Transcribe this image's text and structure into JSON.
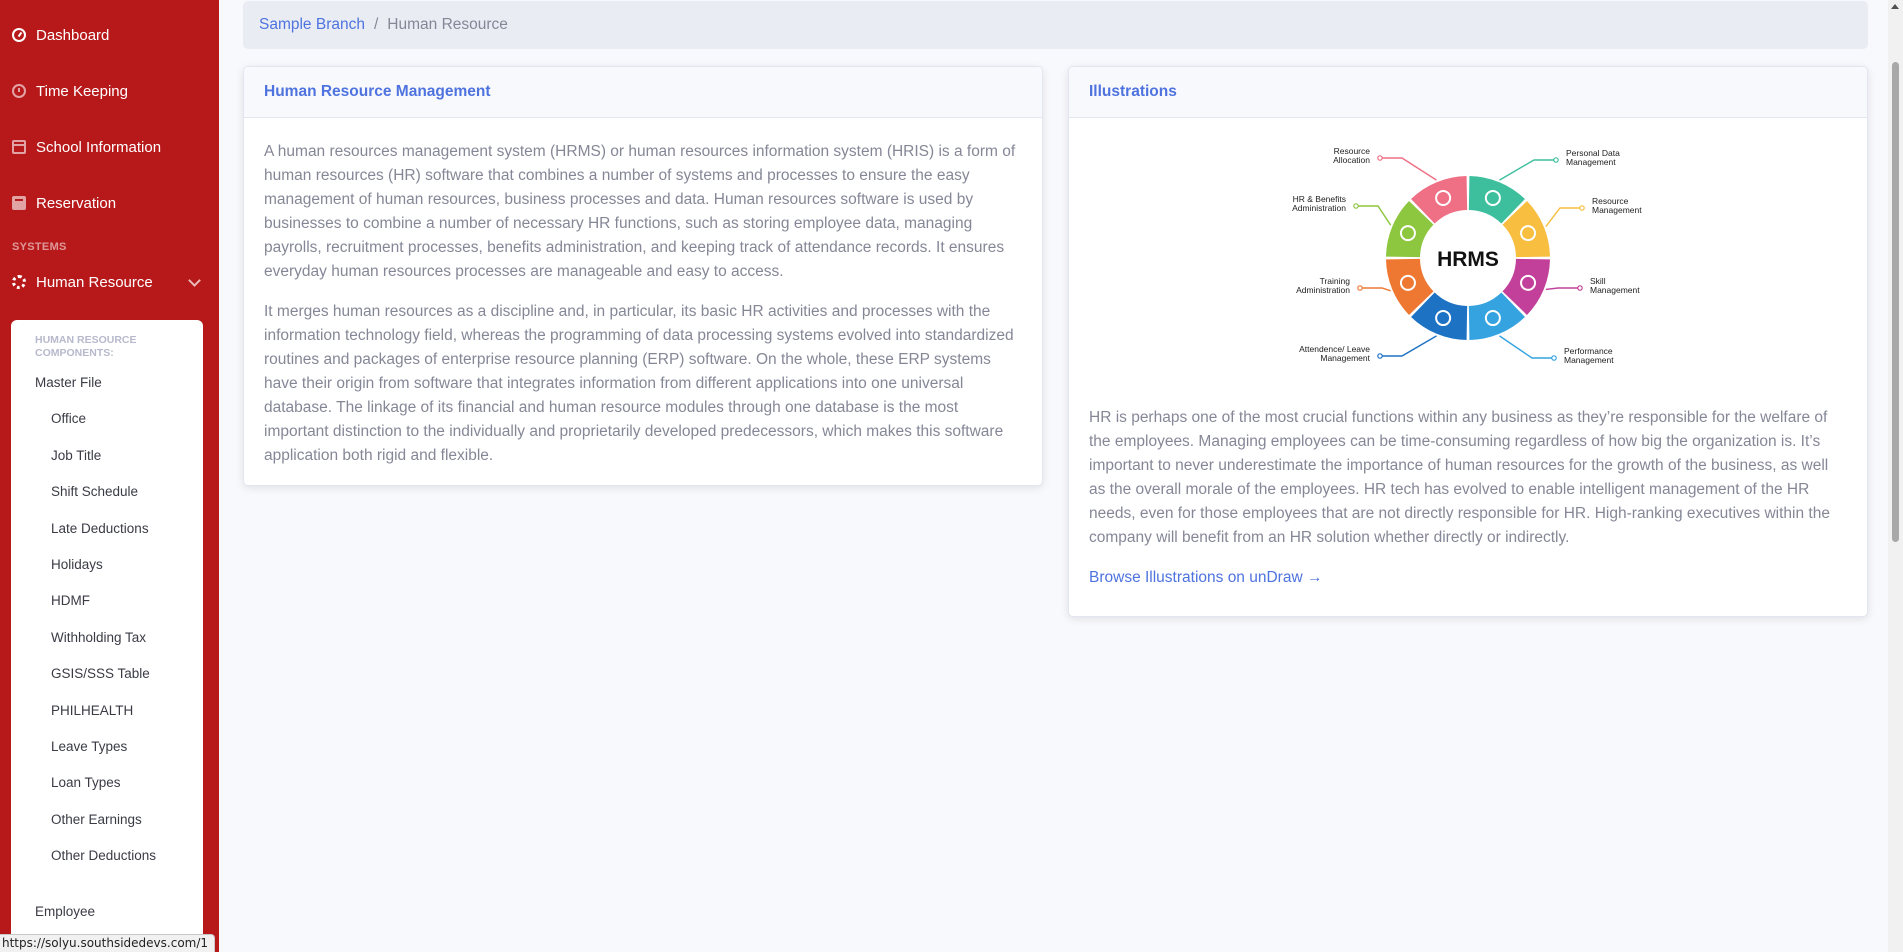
{
  "sidebar": {
    "nav_items": [
      {
        "label": "Dashboard",
        "icon": "tachometer-icon"
      },
      {
        "label": "Time Keeping",
        "icon": "clock-icon"
      },
      {
        "label": "School Information",
        "icon": "calendar-icon"
      },
      {
        "label": "Reservation",
        "icon": "book-icon"
      }
    ],
    "section_heading": "SYSTEMS",
    "active_item": {
      "label": "Human Resource",
      "icon": "cog-icon"
    },
    "submenu": {
      "header": "HUMAN RESOURCE COMPONENTS:",
      "master_file": "Master File",
      "items": [
        "Office",
        "Job Title",
        "Shift Schedule",
        "Late Deductions",
        "Holidays",
        "HDMF",
        "Withholding Tax",
        "GSIS/SSS Table",
        "PHILHEALTH",
        "Leave Types",
        "Loan Types",
        "Other Earnings",
        "Other Deductions"
      ],
      "employee": "Employee"
    }
  },
  "breadcrumb": {
    "branch": "Sample Branch",
    "separator": "/",
    "current": "Human Resource"
  },
  "hrm_card": {
    "title": "Human Resource Management",
    "paragraph1": "A human resources management system (HRMS) or human resources information system (HRIS) is a form of human resources (HR) software that combines a number of systems and processes to ensure the easy management of human resources, business processes and data. Human resources software is used by businesses to combine a number of necessary HR functions, such as storing employee data, managing payrolls, recruitment processes, benefits administration, and keeping track of attendance records. It ensures everyday human resources processes are manageable and easy to access.",
    "paragraph2": "It merges human resources as a discipline and, in particular, its basic HR activities and processes with the information technology field, whereas the programming of data processing systems evolved into standardized routines and packages of enterprise resource planning (ERP) software. On the whole, these ERP systems have their origin from software that integrates information from different applications into one universal database. The linkage of its financial and human resource modules through one database is the most important distinction to the individually and proprietarily developed predecessors, which makes this software application both rigid and flexible."
  },
  "illus_card": {
    "title": "Illustrations",
    "diagram": {
      "center": "HRMS",
      "labels": {
        "resource_allocation": [
          "Resource",
          "Allocation"
        ],
        "personal_data": [
          "Personal Data",
          "Management"
        ],
        "hr_benefits": [
          "HR & Benefits",
          "Administration"
        ],
        "resource_management": [
          "Resource",
          "Management"
        ],
        "training": [
          "Training",
          "Administration"
        ],
        "skill": [
          "Skill",
          "Management"
        ],
        "attendance": [
          "Attendence/ Leave",
          "Management"
        ],
        "performance": [
          "Performance",
          "Management"
        ]
      },
      "colors": [
        "#3dbf9e",
        "#f7be3f",
        "#c2409a",
        "#34a3e0",
        "#1d72c4",
        "#ee7832",
        "#8dc63f",
        "#ef6f84"
      ]
    },
    "text": "HR is perhaps one of the most crucial functions within any business as they’re responsible for the welfare of the employees. Managing employees can be time-consuming regardless of how big the organization is. It’s important to never underestimate the importance of human resources for the growth of the business, as well as the overall morale of the employees. HR tech has evolved to enable intelligent management of the HR needs, even for those employees that are not directly responsible for HR. High-ranking executives within the company will benefit from an HR solution whether directly or indirectly.",
    "link": "Browse Illustrations on unDraw →"
  },
  "status_url": "https://solyu.southsidedevs.com/1",
  "colors": {
    "sidebar_bg": "#b7191b",
    "primary": "#4e73df",
    "body_text": "#858796"
  }
}
